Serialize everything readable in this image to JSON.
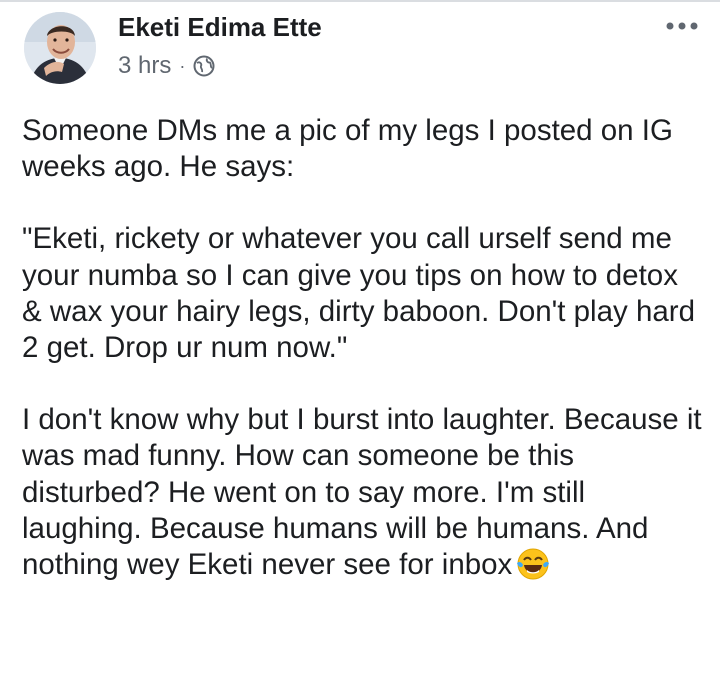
{
  "post": {
    "author": {
      "name": "Eketi Edima Ette",
      "avatar_icon": "user-avatar-photo"
    },
    "timestamp": "3 hrs",
    "separator": "·",
    "privacy_icon": "globe-icon",
    "menu_icon": "more-horizontal-icon",
    "paragraphs": [
      "Someone DMs me a pic of my legs I posted on IG weeks ago. He says:",
      "\"Eketi, rickety or whatever you call urself send me your numba so I can give you tips on how to detox & wax your hairy legs, dirty baboon. Don't play hard 2 get. Drop ur num now.\"",
      "I don't know why but I burst into laughter. Because it was mad funny. How can someone be this disturbed? He went on to say more. I'm still laughing. Because humans will be humans. And nothing wey Eketi never see for inbox"
    ],
    "trailing_emoji": "face-with-tears-of-joy-emoji"
  },
  "colors": {
    "text_primary": "#1c1e21",
    "text_secondary": "#606770",
    "divider": "#dadde1"
  }
}
